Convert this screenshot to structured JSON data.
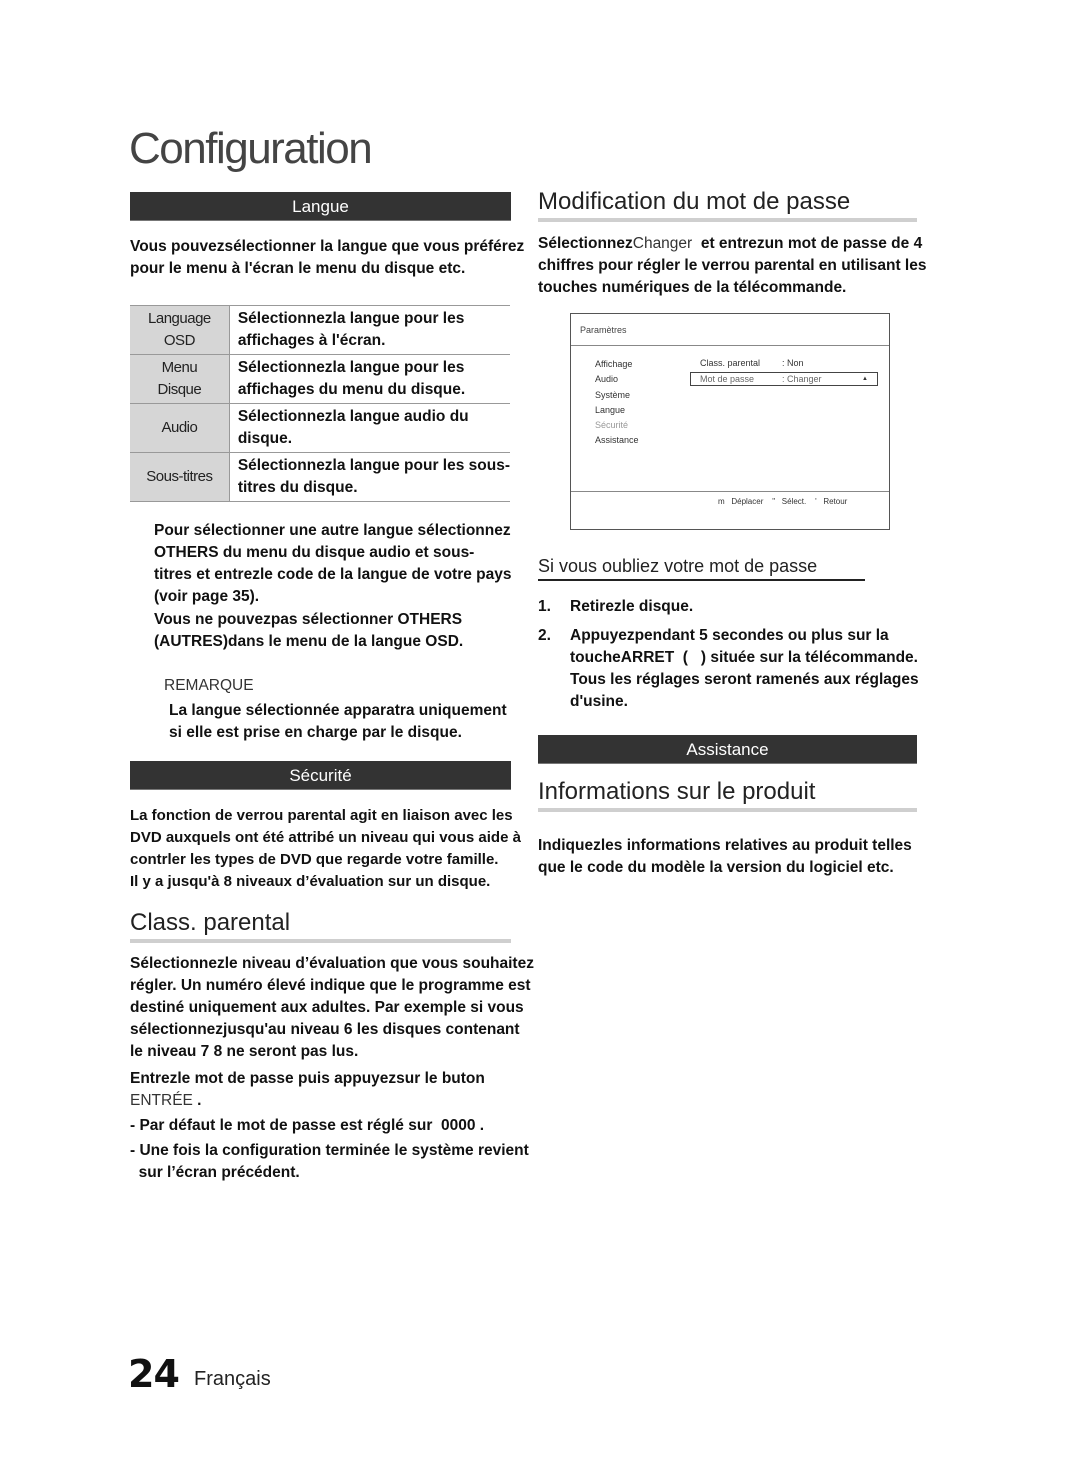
{
  "page": {
    "title": "Configuration",
    "page_number": "24",
    "language": "Français"
  },
  "left": {
    "langue_bar": "Langue",
    "langue_intro": [
      "Vous pouvezsélectionner la langue que vous préférez",
      "pour le menu à l'écran le menu du disque etc."
    ],
    "lang_table": [
      {
        "key": [
          "Language",
          "OSD"
        ],
        "value": [
          "Sélectionnezla langue pour les",
          "affichages à l'écran."
        ]
      },
      {
        "key": [
          "Menu",
          "Disque"
        ],
        "value": [
          "Sélectionnezla langue pour les",
          "affichages du menu du disque."
        ]
      },
      {
        "key": [
          "Audio"
        ],
        "value": [
          "Sélectionnezla langue audio du",
          "disque."
        ]
      },
      {
        "key": [
          "Sous-titres"
        ],
        "value": [
          "Sélectionnezla langue pour les sous-",
          "titres du disque."
        ]
      }
    ],
    "others_text": [
      "Pour sélectionner une autre langue sélectionnez",
      "OTHERS du menu du disque audio et sous-",
      "titres et entrezle code de la langue de votre pays",
      "(voir page 35)."
    ],
    "others_note": [
      "Vous ne pouvezpas sélectionner OTHERS",
      "(AUTRES)dans le menu de la langue OSD."
    ],
    "remarque_label": "REMARQUE",
    "remarque_text": [
      "La langue sélectionnée apparatra uniquement",
      "si elle est prise en charge par le disque."
    ],
    "securite_bar": "Sécurité",
    "securite_text": [
      "La fonction de verrou parental agit en liaison avec les",
      "DVD auxquels ont été attribé un niveau qui vous aide à",
      "contrler les types de DVD que regarde votre famille.",
      "Il y a jusqu'à 8 niveaux d’évaluation sur un disque."
    ],
    "class_heading": "Class. parental",
    "class_text": [
      "Sélectionnezle niveau d’évaluation que vous souhaitez",
      "régler. Un numéro élevé indique que le programme est",
      "destiné uniquement aux adultes. Par exemple si vous",
      "sélectionnezjusqu'au niveau 6 les disques contenant",
      "le niveau 7 8 ne seront pas lus."
    ],
    "entrez_text": "Entrezle mot de passe puis appuyezsur le buton",
    "entree_key": "ENTRÉE",
    "entree_suffix": " .",
    "bullet_1": "- Par défaut le mot de passe est réglé sur  0000 .",
    "bullet_2": [
      "- Une fois la configuration terminée le système revient",
      "  sur l’écran précédent."
    ]
  },
  "right": {
    "modif_heading": "Modification du mot de passe",
    "modif_text_1a": "Sélectionnez",
    "modif_text_1b": "Changer",
    "modif_text_1c": "  et entrezun mot de passe de 4",
    "modif_text_rest": [
      "chiffres pour régler le verrou parental en utilisant les",
      "touches numériques de la télécommande."
    ],
    "osd": {
      "header": "Paramètres",
      "menu": [
        {
          "label": "Affichage",
          "dim": false
        },
        {
          "label": "Audio",
          "dim": false
        },
        {
          "label": "Système",
          "dim": false
        },
        {
          "label": "Langue",
          "dim": false
        },
        {
          "label": "Sécurité",
          "dim": true
        },
        {
          "label": "Assistance",
          "dim": false
        }
      ],
      "rows": [
        {
          "label": "Class. parental",
          "value": ": Non",
          "selected": false
        },
        {
          "label": "Mot de passe",
          "value": ": Changer",
          "selected": true
        }
      ],
      "arrow_glyph": "▲",
      "footer": [
        {
          "glyph": "m",
          "label": "Déplacer"
        },
        {
          "glyph": "\"",
          "label": "Sélect."
        },
        {
          "glyph": "'",
          "label": "Retour"
        }
      ]
    },
    "oubli_heading": "Si vous oubliez votre mot de passe",
    "steps": [
      {
        "n": "1.",
        "lines": [
          "Retirezle disque."
        ]
      },
      {
        "n": "2.",
        "lines": [
          "Appuyezpendant 5 secondes ou plus sur la",
          "toucheARRET  (   ) située sur la télécommande.",
          "Tous les réglages seront ramenés aux réglages",
          "d'usine."
        ]
      }
    ],
    "assistance_bar": "Assistance",
    "info_heading": "Informations sur le produit",
    "info_text": [
      "Indiquezles informations relatives au produit telles",
      "que le code du modèle la version du logiciel etc."
    ]
  }
}
